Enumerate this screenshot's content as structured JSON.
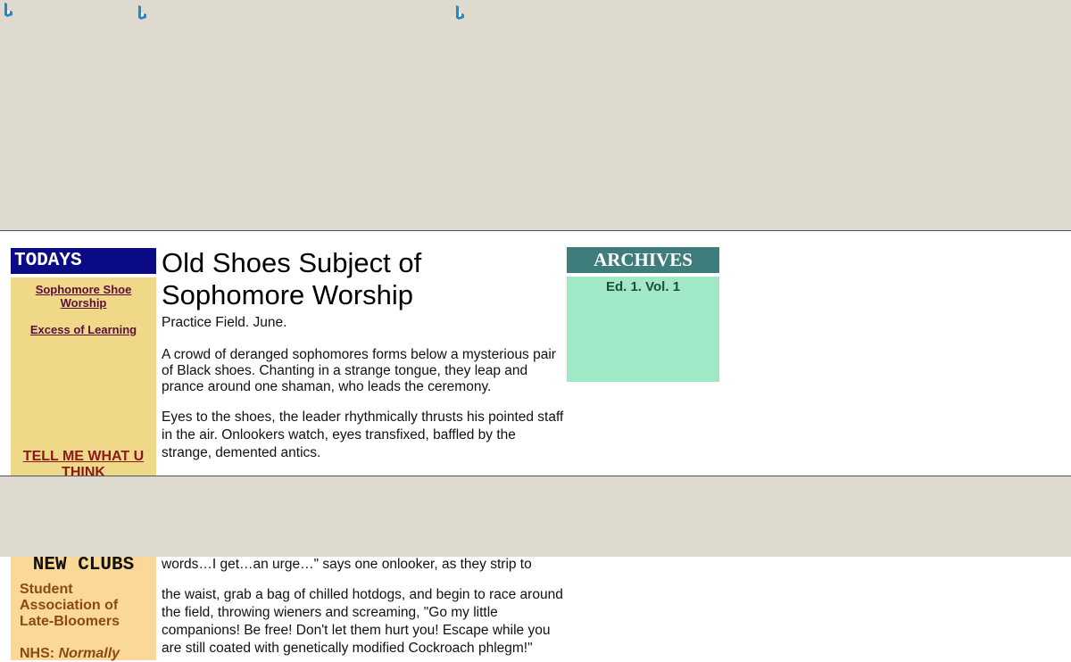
{
  "icons": {
    "ad_icon_1": "bing-b-icon",
    "ad_icon_2": "bing-b-icon",
    "ad_icon_3": "bing-b-icon"
  },
  "sidebar": {
    "heading": "TODAYS",
    "links": [
      "Sophomore Shoe Worship",
      "Excess of Learning"
    ],
    "feedback_link": "TELL ME WHAT U THINK"
  },
  "clubs": {
    "heading": "NEW CLUBS",
    "items": [
      "Student Association of Late-Bloomers",
      "NHS: Normally"
    ]
  },
  "article": {
    "headline": "Old Shoes Subject of Sophomore Worship",
    "dateline": "Practice Field. June.",
    "paragraphs": [
      "A crowd of deranged sophomores forms below a mysterious pair of Black shoes.  Chanting in a strange tongue, they leap and prance around one shaman, who leads the ceremony.",
      "Eyes to the shoes,  the leader rhythmically thrusts his pointed staff in the air.  Onlookers watch, eyes transfixed, baffled by the strange, demented antics.",
      "words…I get…an urge…\" says one onlooker, as they strip to",
      "the waist, grab a bag of chilled  hotdogs, and begin to race around the field, throwing wieners and screaming, \"Go my little companions! Be free! Don't let them hurt you! Escape while you are still coated with genetically modified Cockroach phlegm!\""
    ]
  },
  "archives": {
    "heading": "ARCHIVES",
    "edition": "Ed. 1. Vol. 1"
  },
  "colors": {
    "todays_header": "#0b0b86",
    "todays_panel": "#efd888",
    "clubs_panel": "#fbd898",
    "archives_header": "#3f7c7c",
    "archives_panel": "#a0e8c6",
    "overlay_band": "#dedad0"
  }
}
